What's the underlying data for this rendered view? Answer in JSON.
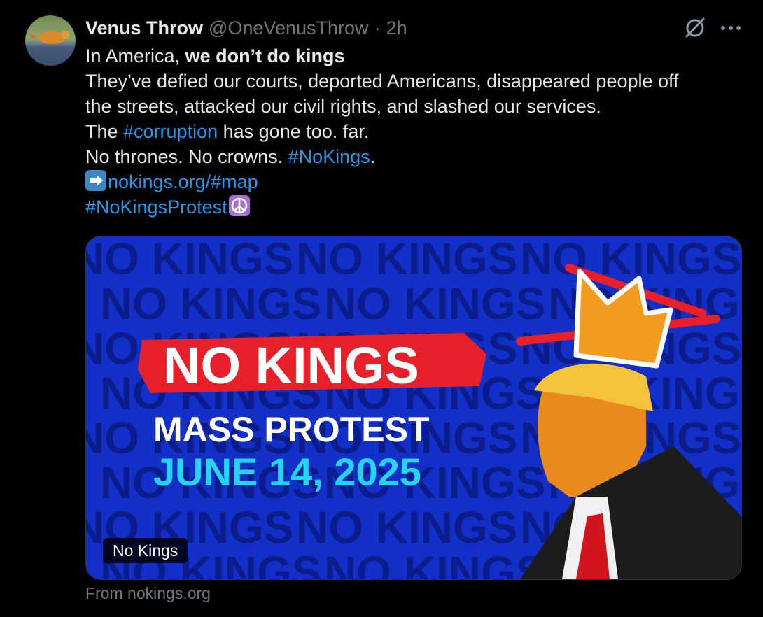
{
  "author": {
    "display_name": "Venus Throw",
    "handle": "@OneVenusThrow",
    "separator": "·",
    "time": "2h"
  },
  "tweet": {
    "line1_prefix": "In America, ",
    "line1_bold": "we don’t do kings",
    "line2": "They’ve defied our courts, deported Americans, disappeared people off",
    "line3": "the streets, attacked our civil rights, and slashed our services.",
    "line4_prefix": "The ",
    "line4_hashtag": "#corruption",
    "line4_suffix": " has gone too. far.",
    "line5_prefix": "No thrones. No crowns. ",
    "line5_hashtag": "#NoKings",
    "line5_suffix": ".",
    "line6_link": "nokings.org/#map",
    "line7_hashtag": "#NoKingsProtest"
  },
  "card": {
    "headline": "NO KINGS",
    "subhead": "MASS PROTEST",
    "date": "JUNE 14, 2025",
    "background_word": "NO KINGS",
    "badge": "No Kings",
    "source": "From nokings.org"
  },
  "icons": {
    "grok": "grok-icon",
    "more": "more-dots-icon",
    "arrow_emoji": "right-arrow-emoji-icon",
    "peace_emoji": "peace-symbol-emoji-icon",
    "crown": "crown-icon"
  },
  "colors": {
    "background": "#000000",
    "text": "#e7e9ea",
    "muted": "#71767b",
    "link": "#1d9bf0",
    "card_blue": "#1230c8",
    "headline_red": "#e8202a",
    "date_cyan": "#25d3f5"
  }
}
